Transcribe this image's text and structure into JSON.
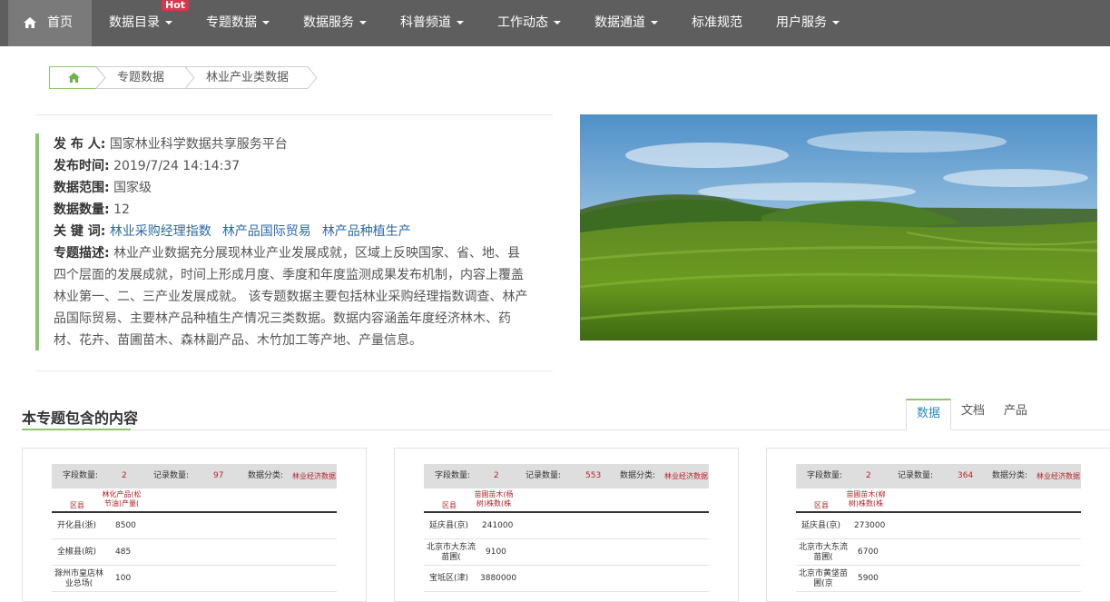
{
  "nav": {
    "home": "首页",
    "hot_badge": "Hot",
    "items": [
      {
        "label": "数据目录"
      },
      {
        "label": "专题数据"
      },
      {
        "label": "数据服务"
      },
      {
        "label": "科普频道"
      },
      {
        "label": "工作动态"
      },
      {
        "label": "数据通道"
      },
      {
        "label": "标准规范"
      },
      {
        "label": "用户服务"
      }
    ]
  },
  "breadcrumb": {
    "items": [
      "专题数据",
      "林业产业类数据"
    ]
  },
  "info": {
    "publisher_label": "发 布 人:",
    "publisher": "国家林业科学数据共享服务平台",
    "time_label": "发布时间:",
    "time": "2019/7/24 14:14:37",
    "scope_label": "数据范围:",
    "scope": "国家级",
    "count_label": "数据数量:",
    "count": "12",
    "keywords_label": "关 键 词:",
    "keywords": [
      "林业采购经理指数",
      "林产品国际贸易",
      "林产品种植生产"
    ],
    "desc_label": "专题描述:",
    "desc": "林业产业数据充分展现林业产业发展成就，区域上反映国家、省、地、县四个层面的发展成就，时间上形成月度、季度和年度监测成果发布机制，内容上覆盖林业第一、二、三产业发展成就。 该专题数据主要包括林业采购经理指数调查、林产品国际贸易、主要林产品种植生产情况三类数据。数据内容涵盖年度经济林木、药材、花卉、苗圃苗木、森林副产品、木竹加工等产地、产量信息。"
  },
  "section": {
    "title": "本专题包含的内容",
    "tabs": [
      "数据",
      "文档",
      "产品"
    ]
  },
  "cards": [
    {
      "field_count_label": "字段数量:",
      "field_count": "2",
      "record_count_label": "记录数量:",
      "record_count": "97",
      "category_label": "数据分类:",
      "category": "林业经济数据",
      "col1": "区县",
      "col2": "林化产品(松节油)产量(",
      "rows": [
        [
          "开化县(浙)",
          "8500"
        ],
        [
          "全椒县(皖)",
          "485"
        ],
        [
          "滁州市皇店林业总场(",
          "100"
        ]
      ]
    },
    {
      "field_count_label": "字段数量:",
      "field_count": "2",
      "record_count_label": "记录数量:",
      "record_count": "553",
      "category_label": "数据分类:",
      "category": "林业经济数据",
      "col1": "区县",
      "col2": "苗圃苗木(杨树)株数(株",
      "rows": [
        [
          "延庆县(京)",
          "241000"
        ],
        [
          "北京市大东流苗圃(",
          "9100"
        ],
        [
          "宝坻区(津)",
          "3880000"
        ]
      ]
    },
    {
      "field_count_label": "字段数量:",
      "field_count": "2",
      "record_count_label": "记录数量:",
      "record_count": "364",
      "category_label": "数据分类:",
      "category": "林业经济数据",
      "col1": "区县",
      "col2": "苗圃苗木(柳树)株数(株",
      "rows": [
        [
          "延庆县(京)",
          "273000"
        ],
        [
          "北京市大东流苗圃(",
          "6700"
        ],
        [
          "北京市黄垡苗圃(京",
          "5900"
        ]
      ]
    }
  ]
}
